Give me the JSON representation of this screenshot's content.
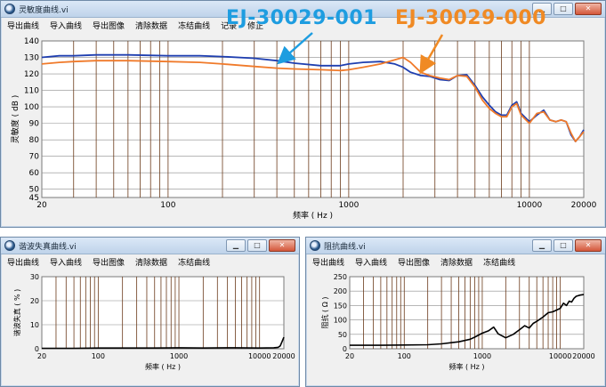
{
  "windows": {
    "sensitivity": {
      "title": "灵敏度曲线.vi",
      "menu": [
        "导出曲线",
        "导入曲线",
        "导出图像",
        "清除数据",
        "冻结曲线",
        "记录",
        "修正"
      ]
    },
    "thd": {
      "title": "谐波失真曲线.vi",
      "menu": [
        "导出曲线",
        "导入曲线",
        "导出图像",
        "清除数据",
        "冻结曲线"
      ]
    },
    "impedance": {
      "title": "阻抗曲线.vi",
      "menu": [
        "导出曲线",
        "导入曲线",
        "导出图像",
        "清除数据",
        "冻结曲线"
      ]
    }
  },
  "controls": {
    "minimize": "▁",
    "maximize": "□",
    "close": "✕"
  },
  "annotations": {
    "blue_label": "EJ-30029-001",
    "orange_label": "EJ-30029-000",
    "blue_color": "#1e9de0",
    "orange_color": "#f08a24"
  },
  "chart_data": [
    {
      "type": "line",
      "xscale": "log",
      "xlabel": "频率 ( Hz )",
      "ylabel": "灵敏度 ( dB )",
      "xlim": [
        20,
        20000
      ],
      "ylim": [
        45,
        140
      ],
      "x_ticks": [
        "20",
        "100",
        "1000",
        "10000",
        "20000"
      ],
      "y_ticks": [
        "45",
        "50",
        "60",
        "70",
        "80",
        "90",
        "100",
        "110",
        "120",
        "130",
        "140"
      ],
      "series": [
        {
          "name": "EJ-30029-001",
          "color": "#1f3fb0",
          "x": [
            20,
            25,
            30,
            40,
            60,
            100,
            150,
            200,
            300,
            400,
            500,
            700,
            900,
            1000,
            1200,
            1500,
            1800,
            2000,
            2200,
            2500,
            2800,
            3200,
            3600,
            4000,
            4500,
            5000,
            5500,
            6000,
            6500,
            7000,
            7500,
            8000,
            8500,
            9000,
            10000,
            11000,
            12000,
            13000,
            14000,
            15000,
            16000,
            17000,
            18000,
            19000,
            20000
          ],
          "y": [
            130,
            131,
            131,
            131.5,
            131.5,
            131,
            131,
            130.5,
            129.5,
            128,
            126.5,
            125,
            125,
            126,
            127,
            127.5,
            126,
            124,
            121,
            119,
            118.5,
            116.5,
            116,
            119,
            119.5,
            113,
            106,
            101,
            97,
            95,
            95,
            101,
            103,
            96,
            91,
            95,
            98,
            92,
            91,
            92,
            91,
            83,
            79,
            82,
            86
          ]
        },
        {
          "name": "EJ-30029-000",
          "color": "#f07a2a",
          "x": [
            20,
            25,
            30,
            40,
            60,
            100,
            150,
            200,
            300,
            400,
            500,
            700,
            900,
            1000,
            1200,
            1500,
            1800,
            2000,
            2200,
            2500,
            2800,
            3200,
            3600,
            4000,
            4500,
            5000,
            5500,
            6000,
            6500,
            7000,
            7500,
            8000,
            8500,
            9000,
            10000,
            11000,
            12000,
            13000,
            14000,
            15000,
            16000,
            17000,
            18000,
            19000,
            20000
          ],
          "y": [
            126,
            127,
            127.5,
            128,
            128,
            127.5,
            127,
            126,
            124.5,
            123.5,
            123,
            122.5,
            122,
            122.5,
            124,
            126,
            128.5,
            130,
            127,
            121,
            119,
            117.5,
            116.5,
            119,
            118.5,
            112,
            104,
            99,
            96,
            94,
            94,
            100,
            102,
            95,
            90,
            96,
            97,
            92,
            91,
            92,
            91,
            84,
            79,
            82,
            85
          ]
        }
      ]
    },
    {
      "type": "line",
      "xscale": "log",
      "xlabel": "频率 ( Hz )",
      "ylabel": "谐波失真 ( % )",
      "xlim": [
        20,
        20000
      ],
      "ylim": [
        0,
        30
      ],
      "x_ticks": [
        "20",
        "100",
        "1000",
        "10000",
        "20000"
      ],
      "y_ticks": [
        "0",
        "10",
        "20",
        "30"
      ],
      "series": [
        {
          "color": "#000000",
          "x": [
            20,
            50,
            100,
            200,
            500,
            1000,
            2000,
            5000,
            10000,
            15000,
            17000,
            18000,
            19000,
            20000
          ],
          "y": [
            0.2,
            0.2,
            0.3,
            0.3,
            0.3,
            0.4,
            0.3,
            0.4,
            0.3,
            0.4,
            0.6,
            1.2,
            3,
            4.8
          ]
        }
      ]
    },
    {
      "type": "line",
      "xscale": "log",
      "xlabel": "频率 ( Hz )",
      "ylabel": "阻抗 ( Ω )",
      "xlim": [
        20,
        20000
      ],
      "ylim": [
        0,
        250
      ],
      "x_ticks": [
        "20",
        "100",
        "1000",
        "10000",
        "20000"
      ],
      "y_ticks": [
        "0",
        "50",
        "100",
        "150",
        "200",
        "250"
      ],
      "series": [
        {
          "color": "#000000",
          "x": [
            20,
            50,
            100,
            200,
            300,
            500,
            700,
            800,
            1000,
            1200,
            1400,
            1600,
            2000,
            2500,
            3000,
            3500,
            4000,
            4500,
            5000,
            6000,
            7000,
            8000,
            10000,
            11000,
            12000,
            13000,
            14000,
            15000,
            16000,
            18000,
            20000
          ],
          "y": [
            12,
            12,
            13,
            14,
            17,
            24,
            33,
            40,
            54,
            62,
            75,
            52,
            38,
            50,
            66,
            80,
            72,
            88,
            95,
            110,
            125,
            128,
            140,
            158,
            150,
            165,
            162,
            175,
            182,
            186,
            188
          ]
        }
      ]
    }
  ]
}
